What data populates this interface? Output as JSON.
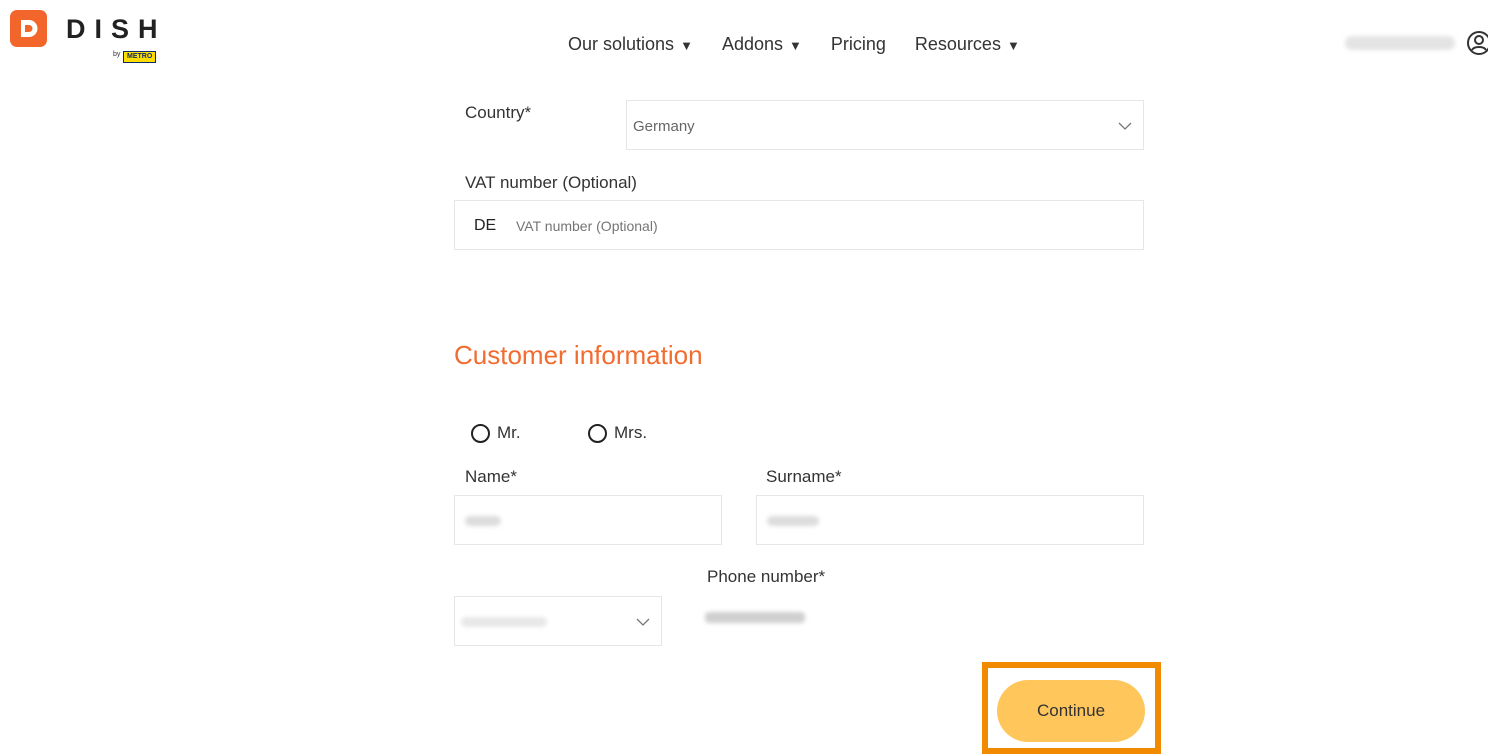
{
  "brand": {
    "name": "DISH",
    "by": "by",
    "partner": "METRO"
  },
  "nav": {
    "items": [
      {
        "label": "Our solutions",
        "has_dropdown": true
      },
      {
        "label": "Addons",
        "has_dropdown": true
      },
      {
        "label": "Pricing",
        "has_dropdown": false
      },
      {
        "label": "Resources",
        "has_dropdown": true
      }
    ],
    "caret": "▼"
  },
  "user": {
    "icon": "user-circle-icon"
  },
  "form": {
    "country_label": "Country*",
    "country_value": "Germany",
    "vat_label": "VAT number (Optional)",
    "vat_prefix": "DE",
    "vat_placeholder": "VAT number (Optional)",
    "section_title": "Customer information",
    "salutation_options": [
      "Mr.",
      "Mrs."
    ],
    "name_label": "Name*",
    "surname_label": "Surname*",
    "phone_label": "Phone number*",
    "continue_label": "Continue"
  },
  "colors": {
    "brand_orange": "#f2662b",
    "section_title": "#f26b2f",
    "continue_button": "#ffc65c",
    "highlight": "#f28a00"
  }
}
